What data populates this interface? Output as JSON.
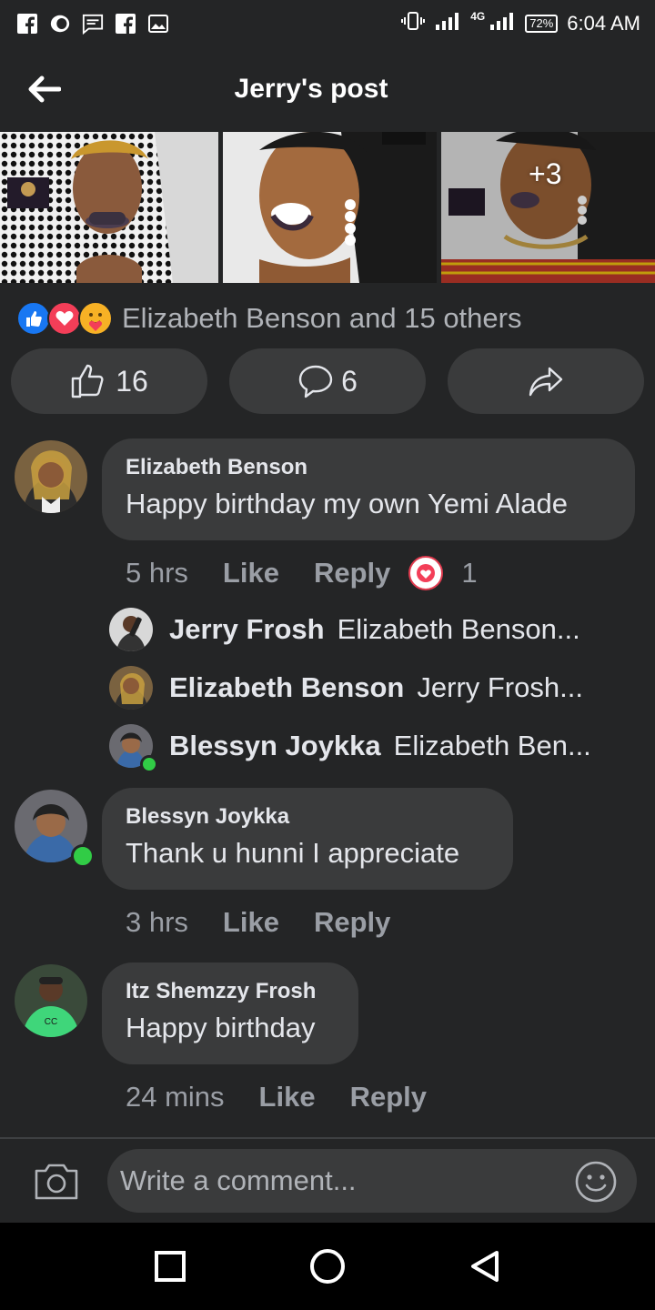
{
  "status_bar": {
    "time": "6:04 AM",
    "battery": "72%",
    "network": "4G",
    "icons": [
      "facebook-icon",
      "opera-icon",
      "message-icon",
      "facebook-icon",
      "gallery-icon"
    ]
  },
  "header": {
    "title": "Jerry's post"
  },
  "photos": {
    "more_count": "+3"
  },
  "reactions": {
    "summary": "Elizabeth Benson and 15 others",
    "icons": [
      "like-icon",
      "love-icon",
      "care-icon"
    ],
    "colors": {
      "like": "#1877f2",
      "love": "#f33e58",
      "care": "#f7b125"
    }
  },
  "actions": {
    "like_count": "16",
    "comment_count": "6"
  },
  "comments": [
    {
      "author": "Elizabeth Benson",
      "text": "Happy birthday my own Yemi Alade",
      "time": "5 hrs",
      "like_label": "Like",
      "reply_label": "Reply",
      "reaction_count": "1",
      "replies": [
        {
          "author": "Jerry Frosh",
          "text": "Elizabeth Benson..."
        },
        {
          "author": "Elizabeth Benson",
          "text": "Jerry Frosh..."
        },
        {
          "author": "Blessyn Joykka",
          "text": "Elizabeth Ben..."
        }
      ]
    },
    {
      "author": "Blessyn Joykka",
      "text": "Thank u hunni I appreciate",
      "time": "3 hrs",
      "like_label": "Like",
      "reply_label": "Reply"
    },
    {
      "author": "Itz Shemzzy Frosh",
      "text": "Happy birthday",
      "time": "24 mins",
      "like_label": "Like",
      "reply_label": "Reply"
    }
  ],
  "composer": {
    "placeholder": "Write a comment..."
  },
  "colors": {
    "background": "#242526",
    "bubble": "#3a3b3c",
    "online": "#31cc46"
  }
}
